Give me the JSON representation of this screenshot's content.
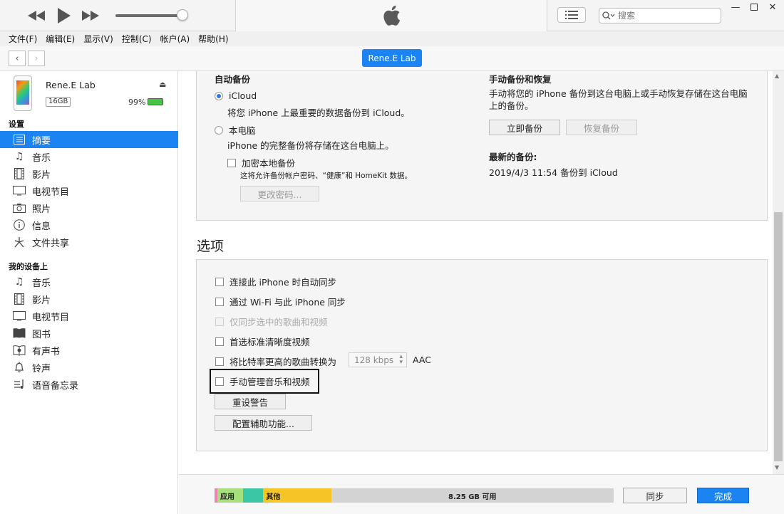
{
  "search": {
    "placeholder": "搜索"
  },
  "menu": [
    "文件(F)",
    "编辑(E)",
    "显示(V)",
    "控制(C)",
    "帐户(A)",
    "帮助(H)"
  ],
  "device_tab": "Rene.E Lab",
  "device": {
    "name": "Rene.E Lab",
    "capacity": "16GB",
    "battery_pct": "99%",
    "battery_level": 0.99
  },
  "sidebar": {
    "settings_header": "设置",
    "settings": [
      {
        "label": "摘要",
        "icon": "summary-icon"
      },
      {
        "label": "音乐",
        "icon": "music-note-icon"
      },
      {
        "label": "影片",
        "icon": "film-icon"
      },
      {
        "label": "电视节目",
        "icon": "tv-icon"
      },
      {
        "label": "照片",
        "icon": "camera-icon"
      },
      {
        "label": "信息",
        "icon": "info-icon"
      },
      {
        "label": "文件共享",
        "icon": "file-sharing-icon"
      }
    ],
    "ondevice_header": "我的设备上",
    "ondevice": [
      {
        "label": "音乐",
        "icon": "music-note-icon"
      },
      {
        "label": "影片",
        "icon": "film-icon"
      },
      {
        "label": "电视节目",
        "icon": "tv-icon"
      },
      {
        "label": "图书",
        "icon": "book-icon"
      },
      {
        "label": "有声书",
        "icon": "audiobook-icon"
      },
      {
        "label": "铃声",
        "icon": "bell-icon"
      },
      {
        "label": "语音备忘录",
        "icon": "voice-memo-icon"
      }
    ]
  },
  "backup": {
    "auto_title": "自动备份",
    "icloud_label": "iCloud",
    "icloud_desc": "将您 iPhone 上最重要的数据备份到 iCloud。",
    "local_label": "本电脑",
    "local_desc": "iPhone 的完整备份将存储在这台电脑上。",
    "encrypt_label": "加密本地备份",
    "encrypt_desc": "这将允许备份帐户密码、“健康”和 HomeKit 数据。",
    "change_password": "更改密码...",
    "manual_title": "手动备份和恢复",
    "manual_desc": "手动将您的 iPhone 备份到这台电脑上或手动恢复存储在这台电脑上的备份。",
    "backup_now": "立即备份",
    "restore_backup": "恢复备份",
    "latest_title": "最新的备份:",
    "latest_value": "2019/4/3 11:54 备份到 iCloud"
  },
  "options": {
    "title": "选项",
    "auto_sync": "连接此 iPhone 时自动同步",
    "wifi_sync": "通过 Wi-Fi 与此 iPhone 同步",
    "sync_checked_only": "仅同步选中的歌曲和视频",
    "prefer_sd": "首选标准清晰度视频",
    "convert_bitrate": "将比特率更高的歌曲转换为",
    "bitrate_value": "128 kbps",
    "bitrate_format": "AAC",
    "manual_manage": "手动管理音乐和视频",
    "reset_warnings": "重设警告",
    "accessibility": "配置辅助功能..."
  },
  "storage": {
    "apps_label": "应用",
    "other_label": "其他",
    "free_label": "8.25 GB 可用",
    "segments": [
      {
        "name": "pink",
        "color": "#f27fb8",
        "fraction": 0.007
      },
      {
        "name": "apps",
        "color": "#a6e07c",
        "fraction": 0.065
      },
      {
        "name": "teal",
        "color": "#3ac7a6",
        "fraction": 0.05
      },
      {
        "name": "other",
        "color": "#f5c527",
        "fraction": 0.17
      }
    ]
  },
  "bottom": {
    "sync": "同步",
    "done": "完成"
  },
  "colors": {
    "accent": "#1b84f2",
    "highlight_border": "#111111"
  }
}
